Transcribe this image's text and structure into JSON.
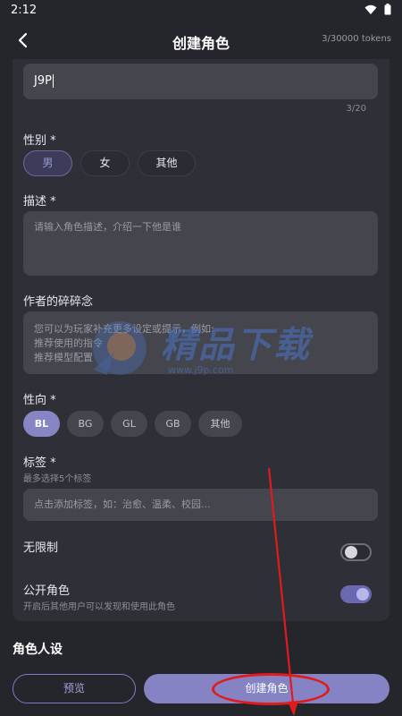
{
  "status_bar": {
    "time": "2:12"
  },
  "header": {
    "title": "创建角色",
    "tokens": "3/30000 tokens"
  },
  "name": {
    "value": "J9P",
    "counter": "3/20"
  },
  "gender": {
    "label": "性别",
    "required": "*",
    "options": [
      {
        "label": "男",
        "selected": true
      },
      {
        "label": "女",
        "selected": false
      },
      {
        "label": "其他",
        "selected": false
      }
    ]
  },
  "description": {
    "label": "描述",
    "required": "*",
    "placeholder": "请输入角色描述，介绍一下他是谁"
  },
  "author_notes": {
    "label": "作者的碎碎念",
    "placeholder_lines": [
      "您可以为玩家补充更多设定或提示，例如:",
      "推荐使用的指令",
      "推荐模型配置"
    ]
  },
  "orientation": {
    "label": "性向",
    "required": "*",
    "options": [
      {
        "label": "BL",
        "selected": true
      },
      {
        "label": "BG",
        "selected": false
      },
      {
        "label": "GL",
        "selected": false
      },
      {
        "label": "GB",
        "selected": false
      },
      {
        "label": "其他",
        "selected": false
      }
    ]
  },
  "tags": {
    "label": "标签",
    "required": "*",
    "hint": "最多选择5个标签",
    "placeholder": "点击添加标签，如：治愈、温柔、校园..."
  },
  "unrestricted": {
    "label": "无限制",
    "enabled": false
  },
  "public": {
    "label": "公开角色",
    "hint": "开启后其他用户可以发现和使用此角色",
    "enabled": true
  },
  "persona_section": {
    "title": "角色人设"
  },
  "actions": {
    "preview_label": "预览",
    "create_label": "创建角色"
  },
  "watermark": {
    "text": "精品下载",
    "url": "www.j9p.com"
  },
  "colors": {
    "accent": "#8583c4",
    "annotation": "#e11b1b",
    "background": "#25252c"
  }
}
